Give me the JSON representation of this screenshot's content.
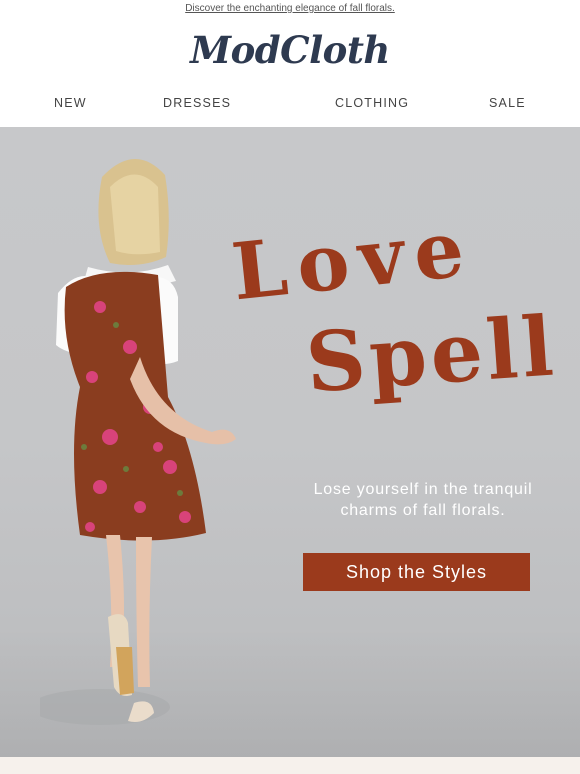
{
  "preheader": {
    "text": "Discover the enchanting elegance of fall florals."
  },
  "brand": {
    "logo_text": "ModCloth",
    "color": "#2e3a50"
  },
  "nav": {
    "items": [
      {
        "label": "NEW"
      },
      {
        "label": "DRESSES"
      },
      {
        "label": "CLOTHING"
      },
      {
        "label": "SALE"
      }
    ]
  },
  "hero": {
    "headline_line1": "Love",
    "headline_line2": "Spell",
    "tagline": "Lose yourself in the tranquil charms of fall florals.",
    "cta_label": "Shop the Styles",
    "accent_color": "#9b3a1c",
    "background_color": "#c6c7c9"
  }
}
